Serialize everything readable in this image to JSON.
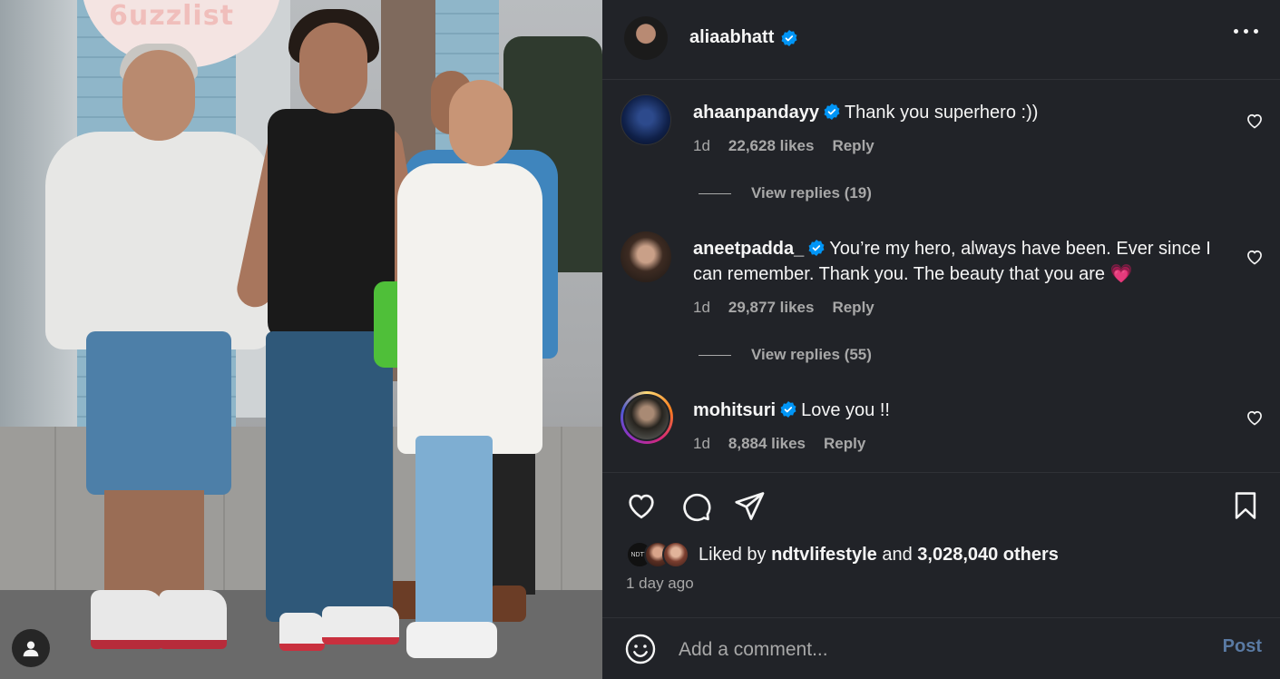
{
  "photo": {
    "sign_text": "6uzzlist",
    "user_tag_icon": "user-icon"
  },
  "header": {
    "username": "aliaabhatt",
    "verified_icon": "verified-badge-icon",
    "more_icon": "more-horizontal-icon"
  },
  "comments": [
    {
      "username": "ahaanpandayy",
      "text": "Thank you superhero :))",
      "time": "1d",
      "likes": "22,628 likes",
      "reply_label": "Reply",
      "view_replies": "View replies (19)"
    },
    {
      "username": "aneetpadda_",
      "text": "You’re my hero, always have been. Ever since I can remember. Thank you. The beauty that you are 💗",
      "time": "1d",
      "likes": "29,877 likes",
      "reply_label": "Reply",
      "view_replies": "View replies (55)"
    },
    {
      "username": "mohitsuri",
      "text": "Love you !!",
      "time": "1d",
      "likes": "8,884 likes",
      "reply_label": "Reply"
    }
  ],
  "actions": {
    "like_icon": "heart-icon",
    "comment_icon": "comment-icon",
    "share_icon": "share-icon",
    "save_icon": "bookmark-icon"
  },
  "likes_summary": {
    "prefix": "Liked by",
    "user": "ndtvlifestyle",
    "and": "and",
    "count": "3,028,040 others",
    "avatar_label": "NDTV"
  },
  "timestamp": "1 day ago",
  "add_comment": {
    "placeholder": "Add a comment...",
    "post_label": "Post",
    "emoji_icon": "emoji-icon"
  },
  "colors": {
    "panel_bg": "#212328",
    "verified": "#0095f6",
    "muted": "#a8a8a8",
    "post_button": "#5a7aa3"
  }
}
